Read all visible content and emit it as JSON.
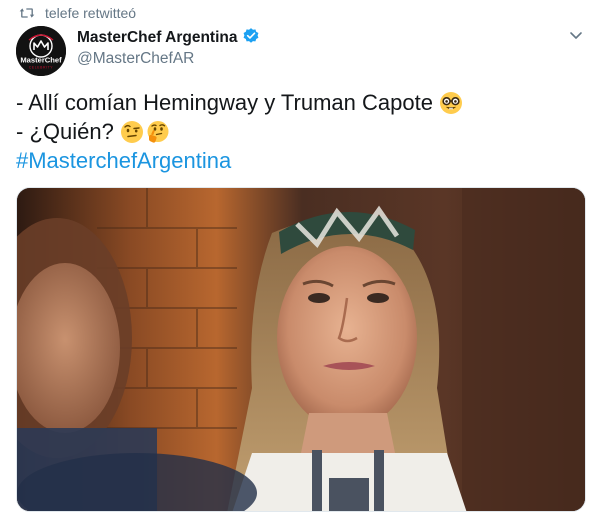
{
  "retweet": {
    "icon": "retweet-icon",
    "label": "telefe retwitteó"
  },
  "author": {
    "display_name": "MasterChef Argentina",
    "handle": "@MasterChefAR",
    "verified": true,
    "verified_color": "#1da1f2",
    "avatar_logo_text_1": "MasterChef",
    "avatar_logo_text_2": "CELEBRITY"
  },
  "tweet": {
    "line1": "- Allí comían Hemingway y Truman Capote",
    "line1_emoji": "nerd-face-emoji",
    "line2": "- ¿Quién?",
    "line2_emojis": [
      "face-with-raised-eyebrow-emoji",
      "thinking-face-emoji"
    ],
    "hashtag": "#MasterchefArgentina",
    "hashtag_color": "#1b95e0"
  },
  "media": {
    "type": "photo",
    "subject": "tweet-photo"
  },
  "menu": {
    "icon": "chevron-down-icon"
  }
}
